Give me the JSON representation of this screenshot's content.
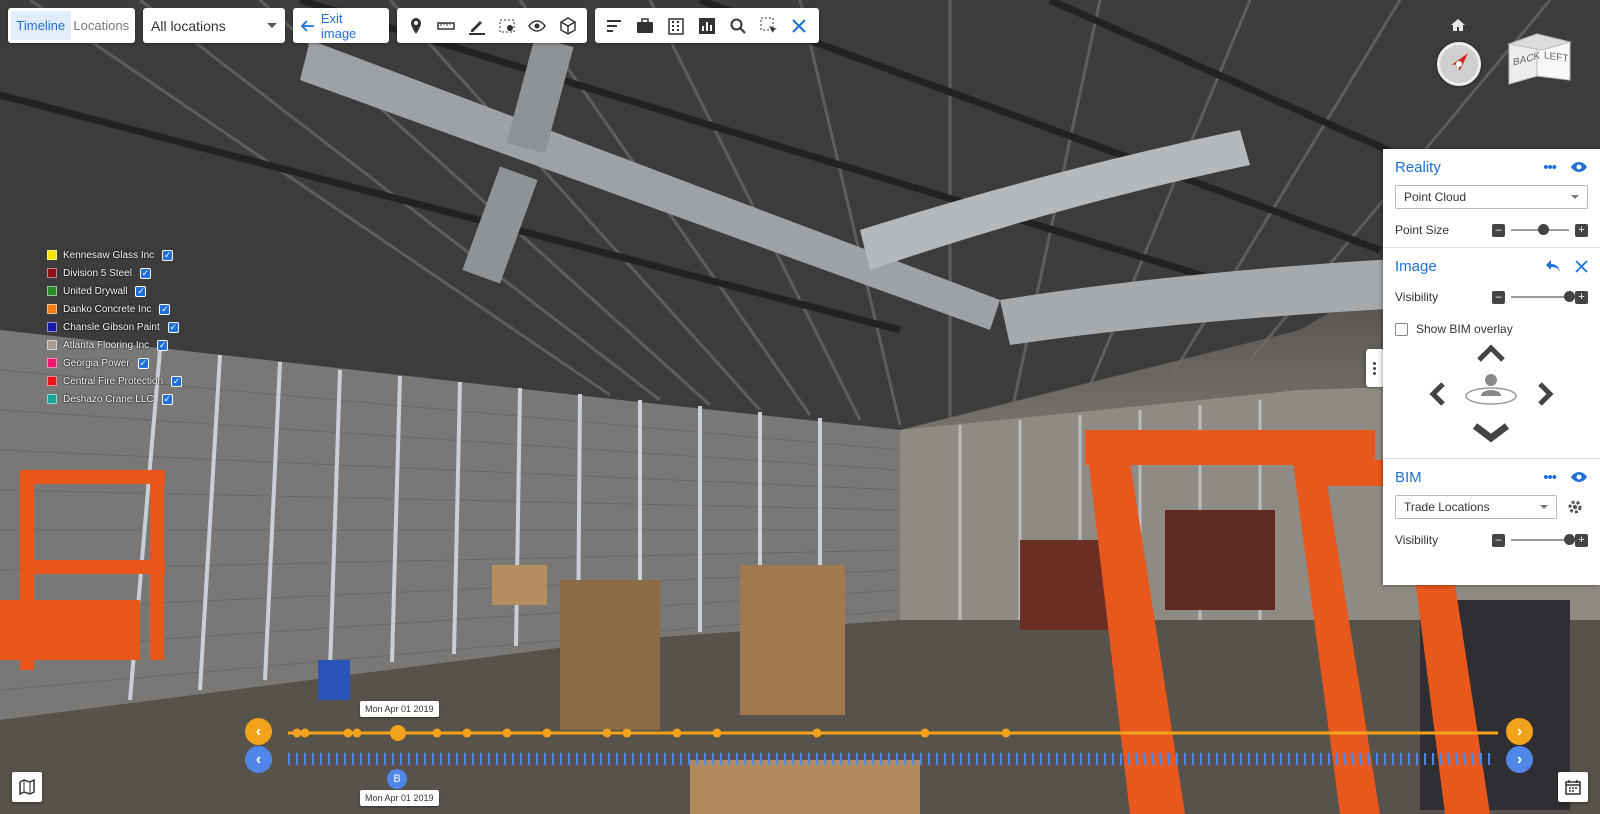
{
  "view_toggle": {
    "timeline": "Timeline",
    "locations": "Locations"
  },
  "location_select": {
    "value": "All locations"
  },
  "exit": {
    "label": "Exit image"
  },
  "toolbar1": [
    "pin-icon",
    "ruler-icon",
    "markup-pen-icon",
    "camera-capture-icon",
    "visibility-icon",
    "cube-box-icon"
  ],
  "toolbar2": [
    "sort-lines-icon",
    "briefcase-icon",
    "building-icon",
    "bar-chart-icon",
    "search-icon",
    "select-area-icon",
    "close-icon"
  ],
  "legend": [
    {
      "name": "Kennesaw Glass Inc",
      "color": "#f5e400",
      "checked": true
    },
    {
      "name": "Division 5 Steel",
      "color": "#8b1010",
      "checked": true
    },
    {
      "name": "United Drywall",
      "color": "#2a8a2a",
      "checked": true
    },
    {
      "name": "Danko Concrete Inc",
      "color": "#f07d17",
      "checked": true
    },
    {
      "name": "Chansle Gibson Paint",
      "color": "#1a1aa8",
      "checked": true
    },
    {
      "name": "Atlanta Flooring Inc",
      "color": "#a99a92",
      "checked": true
    },
    {
      "name": "Georgia Power",
      "color": "#f0186e",
      "checked": true
    },
    {
      "name": "Central Fire Protection",
      "color": "#e8141a",
      "checked": true
    },
    {
      "name": "Deshazo Crane LLC",
      "color": "#1aa89a",
      "checked": true
    }
  ],
  "nav_cube": {
    "back": "BACK",
    "left": "LEFT"
  },
  "panel": {
    "reality": {
      "title": "Reality",
      "mode": "Point Cloud",
      "point_size_label": "Point Size",
      "point_size_level": 0.55
    },
    "image": {
      "title": "Image",
      "visibility_label": "Visibility",
      "visibility_level": 1.0,
      "bim_overlay_label": "Show BIM overlay",
      "bim_overlay_checked": false
    },
    "bim": {
      "title": "BIM",
      "mode": "Trade Locations",
      "visibility_label": "Visibility",
      "visibility_level": 1.0
    }
  },
  "timeline": {
    "top_date": "Mon Apr 01 2019",
    "bottom_date": "Mon Apr 01 2019",
    "marker_label": "B",
    "accent_orange": "#f2a21b",
    "accent_blue": "#4f86e8"
  },
  "colors": {
    "primary": "#1f6fd8"
  }
}
